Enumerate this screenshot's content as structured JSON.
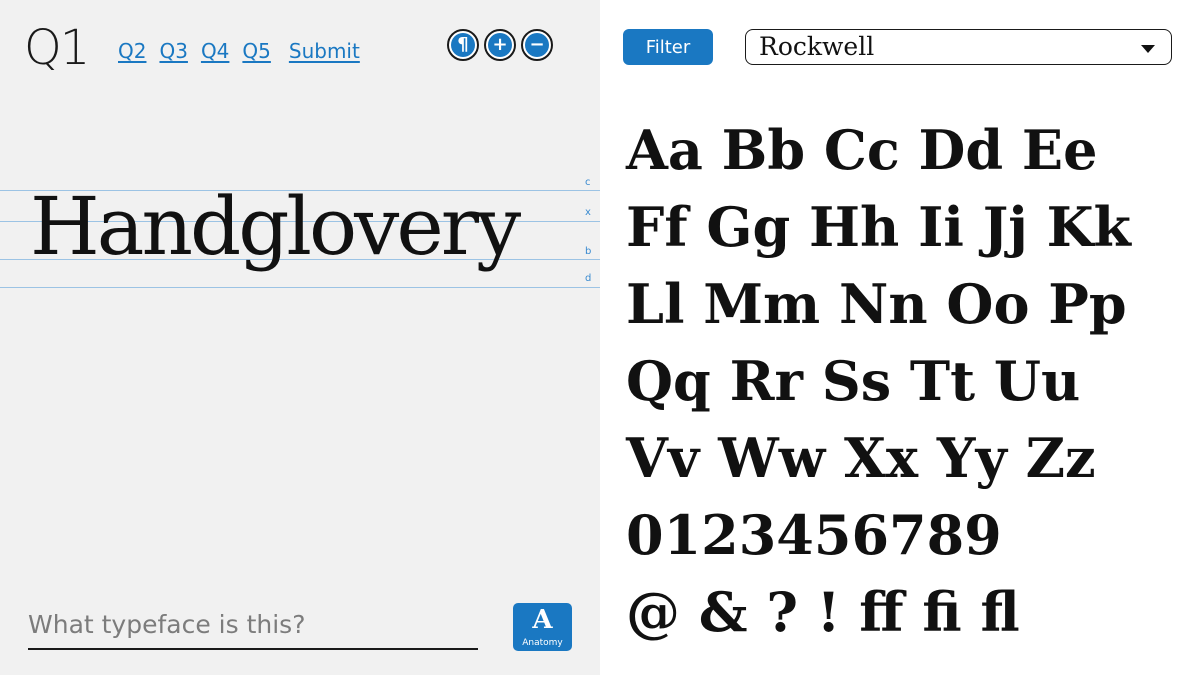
{
  "nav": {
    "current": "Q1",
    "links": [
      "Q2",
      "Q3",
      "Q4",
      "Q5"
    ],
    "submit": "Submit"
  },
  "tools": {
    "paragraph_glyph": "¶",
    "plus_glyph": "+",
    "minus_glyph": "−"
  },
  "specimen": {
    "word": "Handglovery",
    "guides": {
      "c": "c",
      "x": "x",
      "b": "b",
      "d": "d"
    }
  },
  "answer": {
    "placeholder": "What typeface is this?",
    "value": ""
  },
  "anatomy": {
    "glyph": "A",
    "label": "Anatomy"
  },
  "filter": {
    "label": "Filter"
  },
  "font_select": {
    "selected": "Rockwell"
  },
  "charset": {
    "rows": [
      "Aa Bb Cc Dd Ee",
      "Ff Gg Hh Ii Jj Kk",
      "Ll Mm Nn Oo Pp",
      "Qq Rr Ss Tt Uu",
      "Vv Ww Xx Yy Zz",
      "0123456789",
      "@ & ? ! ff fi fl"
    ]
  },
  "colors": {
    "accent": "#1a78c2",
    "panel_bg": "#f1f1f1",
    "guide": "#9cc3e4"
  }
}
